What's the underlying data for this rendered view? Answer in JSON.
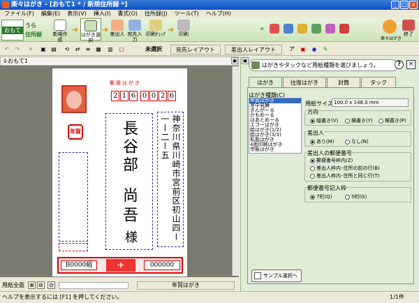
{
  "window": {
    "title": "楽々はがき - [おもて1 * / 新規住所録 *]",
    "min": "_",
    "max": "□",
    "close": "×"
  },
  "menu": [
    "ファイル(F)",
    "編集(E)",
    "表示(V)",
    "挿入(I)",
    "書式(O)",
    "住所録(J)",
    "ツール(T)",
    "ヘルプ(H)"
  ],
  "toolbar": {
    "omote": "おもて",
    "ura": "うら",
    "jushoroku": "住所録",
    "new_create": "新規作成",
    "hagaki_select": "はがき選択",
    "sashidashi": "差出人",
    "atesaki": "宛先入力",
    "print_check": "印刷ﾁｪｯｸ",
    "print": "印刷",
    "sample": "楽々はがき",
    "exit": "終了"
  },
  "toolbar2": {
    "unselected": "未選択",
    "atesaki_layout": "宛先レイアウト",
    "sashidashi_layout": "差出人レイアウト"
  },
  "doc_tab": "①おもて1",
  "postcard": {
    "header": "郵便はがき",
    "zip": [
      "2",
      "1",
      "6",
      "0",
      "0",
      "2",
      "6"
    ],
    "address": "神奈川県川崎市宮前区初山四ー一ー二ー五",
    "name_family": "長谷部",
    "name_given": "尚吾",
    "sama": "様",
    "nenga": "年賀",
    "lottery_left": "B0000組",
    "lottery_right": "000000"
  },
  "status": {
    "zoom_label": "用紙全面",
    "paper_name": "年賀はがき",
    "help": "ヘルプを表示するには [F1] を押してください。",
    "page": "1/1件"
  },
  "hint": "はがきやタックなど用紙種類を選びましょう。",
  "tabs": [
    "はがき",
    "往復はがき",
    "封筒",
    "タック"
  ],
  "panel": {
    "type_label": "はがき種類(C)",
    "types": [
      "年賀はがき",
      "寒中見舞",
      "ぎんがーる",
      "かもめーる",
      "はあとめーる",
      "エコーはがき",
      "絵はがき(1/2)",
      "絵はがき(3/3)",
      "私製はがき",
      "4面印刷はがき",
      "市販はがき"
    ],
    "size_label": "用紙サイズ:",
    "size_value": "100.0 x 148.0 mm",
    "direction_label": "方向",
    "dir_options": [
      "縦書き(V)",
      "横書き(Y)",
      "横置き(P)"
    ],
    "sender_label": "差出人",
    "sender_options": [
      "あり(M)",
      "なし(N)"
    ],
    "zipnum_label": "差出人の郵便番号",
    "zip_options": [
      "郵便番号枠内(Z)",
      "差出人枠内･住所の前の行(B)",
      "差出人枠内･住所と同じ行(T)"
    ],
    "zipbox_label": "郵便番号記入枠",
    "zipbox_options": [
      "7桁(Q)",
      "5桁(G)"
    ],
    "sample_button": "サンプル選択へ"
  },
  "colors": {
    "accent": "#2d7a2d",
    "title_blue": "#0a4fc9",
    "red": "#d00000"
  }
}
